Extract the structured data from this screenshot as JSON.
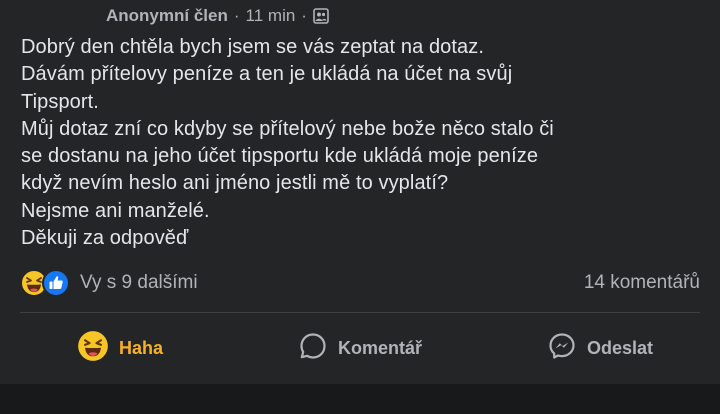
{
  "post": {
    "author": "Anonymní člen",
    "time": "11 min",
    "separator": "·",
    "lines": [
      "Dobrý den chtěla bych jsem se vás zeptat na dotaz.",
      "Dávám přítelovy peníze a ten je ukládá na účet na svůj",
      "Tipsport.",
      "Můj dotaz zní co kdyby se přítelový nebe bože něco stalo či",
      "se dostanu na jeho účet tipsportu kde ukládá moje peníze",
      "když nevím heslo ani jméno jestli mě to vyplatí?",
      "Nejsme ani manželé.",
      "Děkuji za odpověď"
    ]
  },
  "reactions": {
    "summary": "Vy s 9 dalšími",
    "comments": "14 komentářů",
    "icons": [
      "haha-emoji-icon",
      "like-icon"
    ]
  },
  "actions": {
    "haha_label": "Haha",
    "comment_label": "Komentář",
    "share_label": "Odeslat"
  },
  "colors": {
    "background": "#242526",
    "text": "#e4e6eb",
    "secondary": "#b0b3b8",
    "haha_accent": "#f7b125",
    "like_blue": "#1877f2"
  }
}
